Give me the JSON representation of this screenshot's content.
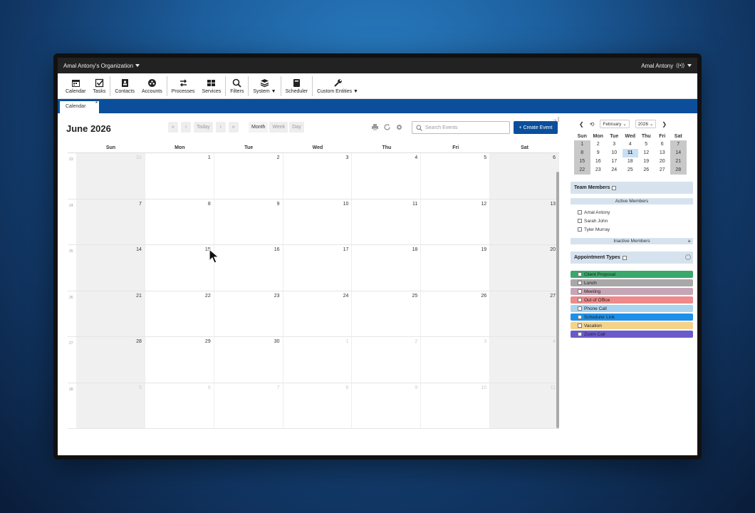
{
  "topbar": {
    "org": "Amal Antony's Organization",
    "user": "Amal Antony"
  },
  "toolbar": {
    "items": [
      {
        "label": "Calendar",
        "icon": "calendar-icon"
      },
      {
        "label": "Tasks",
        "icon": "tasks-icon"
      },
      {
        "label": "Contacts",
        "icon": "contacts-icon"
      },
      {
        "label": "Accounts",
        "icon": "accounts-icon"
      },
      {
        "label": "Processes",
        "icon": "processes-icon"
      },
      {
        "label": "Services",
        "icon": "services-icon"
      },
      {
        "label": "Filters",
        "icon": "search-icon"
      },
      {
        "label": "System ▼",
        "icon": "stack-icon"
      },
      {
        "label": "Scheduler",
        "icon": "book-icon"
      },
      {
        "label": "Custom Entities ▼",
        "icon": "wrench-icon"
      }
    ]
  },
  "tab": {
    "label": "Calendar",
    "star": "*"
  },
  "calendar": {
    "title": "June 2026",
    "nav": [
      "«",
      "‹",
      "Today",
      "›",
      "»"
    ],
    "views": [
      "Month",
      "Week",
      "Day"
    ],
    "search_placeholder": "Search Events",
    "create_label": "+ Create Event",
    "days": [
      "Sun",
      "Mon",
      "Tue",
      "Wed",
      "Thu",
      "Fri",
      "Sat"
    ],
    "weeks": [
      {
        "wk": "23",
        "days": [
          "31",
          "1",
          "2",
          "3",
          "4",
          "5",
          "6"
        ]
      },
      {
        "wk": "24",
        "days": [
          "7",
          "8",
          "9",
          "10",
          "11",
          "12",
          "13"
        ]
      },
      {
        "wk": "25",
        "days": [
          "14",
          "15",
          "16",
          "17",
          "18",
          "19",
          "20"
        ]
      },
      {
        "wk": "26",
        "days": [
          "21",
          "22",
          "23",
          "24",
          "25",
          "26",
          "27"
        ]
      },
      {
        "wk": "27",
        "days": [
          "28",
          "29",
          "30",
          "1",
          "2",
          "3",
          "4"
        ]
      },
      {
        "wk": "28",
        "days": [
          "5",
          "6",
          "7",
          "8",
          "9",
          "10",
          "11"
        ]
      }
    ]
  },
  "mini": {
    "month": "February",
    "year": "2026",
    "days": [
      "Sun",
      "Mon",
      "Tue",
      "Wed",
      "Thu",
      "Fri",
      "Sat"
    ],
    "rows": [
      [
        "1",
        "2",
        "3",
        "4",
        "5",
        "6",
        "7"
      ],
      [
        "8",
        "9",
        "10",
        "11",
        "12",
        "13",
        "14"
      ],
      [
        "15",
        "16",
        "17",
        "18",
        "19",
        "20",
        "21"
      ],
      [
        "22",
        "23",
        "24",
        "25",
        "26",
        "27",
        "28"
      ]
    ],
    "today": "11"
  },
  "team": {
    "title": "Team Members",
    "active_label": "Active Members",
    "members": [
      "Amal Antony",
      "Sarah John",
      "Tyler Murray"
    ],
    "inactive_label": "Inactive Members",
    "plus": "+"
  },
  "appointments": {
    "title": "Appointment Types",
    "types": [
      {
        "label": "Client Proposal",
        "color": "#3aa86b"
      },
      {
        "label": "Lunch",
        "color": "#a8a8a8"
      },
      {
        "label": "Meeting",
        "color": "#c6a6b6"
      },
      {
        "label": "Out of Office",
        "color": "#ee8a8a"
      },
      {
        "label": "Phone Call",
        "color": "#a9d3ee"
      },
      {
        "label": "Scheduler Link",
        "color": "#1e90e8"
      },
      {
        "label": "Vacation",
        "color": "#f5d28a"
      },
      {
        "label": "Zoom Call",
        "color": "#6a5acd"
      }
    ]
  }
}
